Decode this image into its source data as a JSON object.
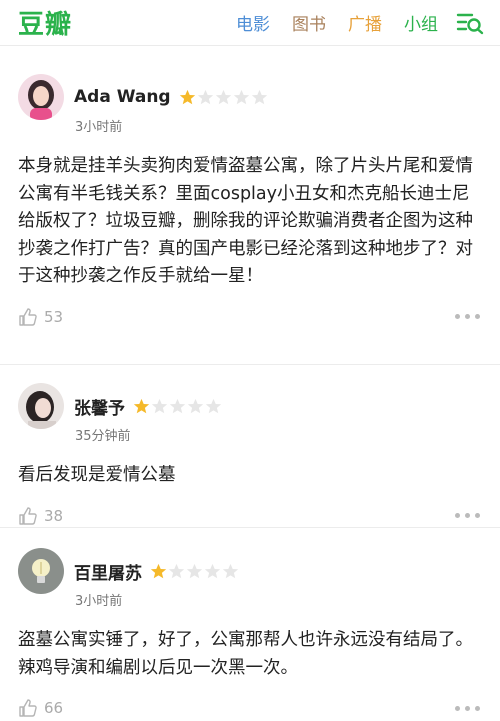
{
  "header": {
    "logo": "豆瓣",
    "nav": [
      {
        "label": "电影",
        "color": "#4e8ed6"
      },
      {
        "label": "图书",
        "color": "#a9815c"
      },
      {
        "label": "广播",
        "color": "#e7a13a"
      },
      {
        "label": "小组",
        "color": "#2bb24c"
      }
    ],
    "menu_icon": "menu-search-icon"
  },
  "comments": [
    {
      "author": "Ada Wang",
      "rating": 1,
      "time": "3小时前",
      "text": "本身就是挂羊头卖狗肉爱情盗墓公寓，除了片头片尾和爱情公寓有半毛钱关系？里面cosplay小丑女和杰克船长迪士尼给版权了？垃圾豆瓣，删除我的评论欺骗消费者企图为这种抄袭之作打广告？真的国产电影已经沦落到这种地步了？对于这种抄袭之作反手就给一星！",
      "likes": "53"
    },
    {
      "author": "张馨予",
      "rating": 1,
      "time": "35分钟前",
      "text": "看后发现是爱情公墓",
      "likes": "38"
    },
    {
      "author": "百里屠苏",
      "rating": 1,
      "time": "3小时前",
      "text": "盗墓公寓实锤了，好了，公寓那帮人也许永远没有结局了。辣鸡导演和编剧以后见一次黑一次。",
      "likes": "66"
    }
  ],
  "colors": {
    "brand": "#2bb24c",
    "star_on": "#f5b92a",
    "star_off": "#e6e6e6"
  }
}
